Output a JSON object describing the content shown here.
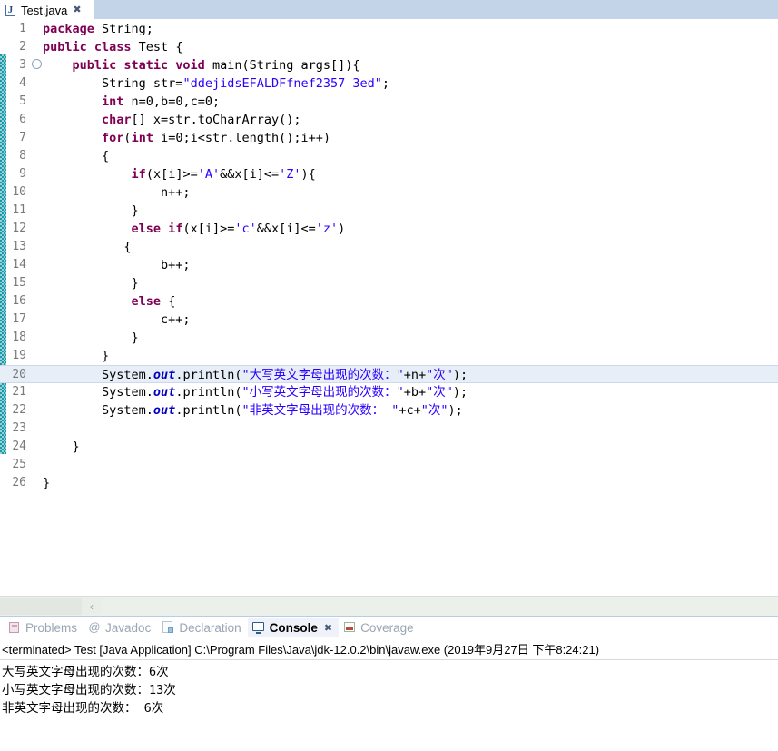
{
  "editor": {
    "tab": {
      "label": "Test.java",
      "icon": "java-file-icon",
      "close": "✖"
    },
    "lines": [
      {
        "n": "1",
        "fold": false,
        "tokens": [
          {
            "t": "kw",
            "v": "package"
          },
          {
            "t": "plain",
            "v": " String;"
          }
        ]
      },
      {
        "n": "2",
        "fold": false,
        "tokens": [
          {
            "t": "kw",
            "v": "public class"
          },
          {
            "t": "plain",
            "v": " Test {"
          }
        ]
      },
      {
        "n": "3",
        "fold": true,
        "tokens": [
          {
            "t": "plain",
            "v": "    "
          },
          {
            "t": "kw",
            "v": "public static void"
          },
          {
            "t": "plain",
            "v": " main(String args[]){"
          }
        ]
      },
      {
        "n": "4",
        "fold": false,
        "tokens": [
          {
            "t": "plain",
            "v": "        String str="
          },
          {
            "t": "str",
            "v": "\"ddejidsEFALDFfnef2357 3ed\""
          },
          {
            "t": "plain",
            "v": ";"
          }
        ]
      },
      {
        "n": "5",
        "fold": false,
        "tokens": [
          {
            "t": "plain",
            "v": "        "
          },
          {
            "t": "kw",
            "v": "int"
          },
          {
            "t": "plain",
            "v": " n=0,b=0,c=0;"
          }
        ]
      },
      {
        "n": "6",
        "fold": false,
        "tokens": [
          {
            "t": "plain",
            "v": "        "
          },
          {
            "t": "kw",
            "v": "char"
          },
          {
            "t": "plain",
            "v": "[] x=str.toCharArray();"
          }
        ]
      },
      {
        "n": "7",
        "fold": false,
        "tokens": [
          {
            "t": "plain",
            "v": "        "
          },
          {
            "t": "kw",
            "v": "for"
          },
          {
            "t": "plain",
            "v": "("
          },
          {
            "t": "kw",
            "v": "int"
          },
          {
            "t": "plain",
            "v": " i=0;i<str.length();i++)"
          }
        ]
      },
      {
        "n": "8",
        "fold": false,
        "tokens": [
          {
            "t": "plain",
            "v": "        {"
          }
        ]
      },
      {
        "n": "9",
        "fold": false,
        "tokens": [
          {
            "t": "plain",
            "v": "            "
          },
          {
            "t": "kw",
            "v": "if"
          },
          {
            "t": "plain",
            "v": "(x[i]>="
          },
          {
            "t": "str",
            "v": "'A'"
          },
          {
            "t": "plain",
            "v": "&&x[i]<="
          },
          {
            "t": "str",
            "v": "'Z'"
          },
          {
            "t": "plain",
            "v": "){"
          }
        ]
      },
      {
        "n": "10",
        "fold": false,
        "tokens": [
          {
            "t": "plain",
            "v": "                n++;"
          }
        ]
      },
      {
        "n": "11",
        "fold": false,
        "tokens": [
          {
            "t": "plain",
            "v": "            }"
          }
        ]
      },
      {
        "n": "12",
        "fold": false,
        "tokens": [
          {
            "t": "plain",
            "v": "            "
          },
          {
            "t": "kw",
            "v": "else if"
          },
          {
            "t": "plain",
            "v": "(x[i]>="
          },
          {
            "t": "str",
            "v": "'c'"
          },
          {
            "t": "plain",
            "v": "&&x[i]<="
          },
          {
            "t": "str",
            "v": "'z'"
          },
          {
            "t": "plain",
            "v": ")"
          }
        ]
      },
      {
        "n": "13",
        "fold": false,
        "tokens": [
          {
            "t": "plain",
            "v": "           {"
          }
        ]
      },
      {
        "n": "14",
        "fold": false,
        "tokens": [
          {
            "t": "plain",
            "v": "                b++;"
          }
        ]
      },
      {
        "n": "15",
        "fold": false,
        "tokens": [
          {
            "t": "plain",
            "v": "            }"
          }
        ]
      },
      {
        "n": "16",
        "fold": false,
        "tokens": [
          {
            "t": "plain",
            "v": "            "
          },
          {
            "t": "kw",
            "v": "else"
          },
          {
            "t": "plain",
            "v": " {"
          }
        ]
      },
      {
        "n": "17",
        "fold": false,
        "tokens": [
          {
            "t": "plain",
            "v": "                c++;"
          }
        ]
      },
      {
        "n": "18",
        "fold": false,
        "tokens": [
          {
            "t": "plain",
            "v": "            }"
          }
        ]
      },
      {
        "n": "19",
        "fold": false,
        "tokens": [
          {
            "t": "plain",
            "v": "        }"
          }
        ]
      },
      {
        "n": "20",
        "fold": false,
        "hl": true,
        "caret_after": 1,
        "tokens": [
          {
            "t": "plain",
            "v": "        System."
          },
          {
            "t": "fld",
            "v": "out"
          },
          {
            "t": "plain",
            "v": ".println("
          },
          {
            "t": "str",
            "v": "\"大写英文字母出现的次数：\""
          },
          {
            "t": "plain",
            "v": "+n"
          },
          {
            "t": "caret",
            "v": ""
          },
          {
            "t": "plain",
            "v": "+"
          },
          {
            "t": "str",
            "v": "\"次\""
          },
          {
            "t": "plain",
            "v": ");"
          }
        ]
      },
      {
        "n": "21",
        "fold": false,
        "tokens": [
          {
            "t": "plain",
            "v": "        System."
          },
          {
            "t": "fld",
            "v": "out"
          },
          {
            "t": "plain",
            "v": ".println("
          },
          {
            "t": "str",
            "v": "\"小写英文字母出现的次数：\""
          },
          {
            "t": "plain",
            "v": "+b+"
          },
          {
            "t": "str",
            "v": "\"次\""
          },
          {
            "t": "plain",
            "v": ");"
          }
        ]
      },
      {
        "n": "22",
        "fold": false,
        "tokens": [
          {
            "t": "plain",
            "v": "        System."
          },
          {
            "t": "fld",
            "v": "out"
          },
          {
            "t": "plain",
            "v": ".println("
          },
          {
            "t": "str",
            "v": "\"非英文字母出现的次数： \""
          },
          {
            "t": "plain",
            "v": "+c+"
          },
          {
            "t": "str",
            "v": "\"次\""
          },
          {
            "t": "plain",
            "v": ");"
          }
        ]
      },
      {
        "n": "23",
        "fold": false,
        "tokens": [
          {
            "t": "plain",
            "v": ""
          }
        ]
      },
      {
        "n": "24",
        "fold": false,
        "tokens": [
          {
            "t": "plain",
            "v": "    }"
          }
        ]
      },
      {
        "n": "25",
        "fold": false,
        "tokens": [
          {
            "t": "plain",
            "v": ""
          }
        ]
      },
      {
        "n": "26",
        "fold": false,
        "tokens": [
          {
            "t": "plain",
            "v": "}"
          }
        ]
      }
    ],
    "hscroll": {
      "left_arrow": "‹"
    }
  },
  "bottom_panel": {
    "tabs": [
      {
        "label": "Problems",
        "icon": "problems-icon",
        "active": false,
        "closable": false
      },
      {
        "label": "Javadoc",
        "icon": "javadoc-icon",
        "active": false,
        "closable": false
      },
      {
        "label": "Declaration",
        "icon": "declaration-icon",
        "active": false,
        "closable": false
      },
      {
        "label": "Console",
        "icon": "console-icon",
        "active": true,
        "closable": true
      },
      {
        "label": "Coverage",
        "icon": "coverage-icon",
        "active": false,
        "closable": false
      }
    ],
    "close_glyph": "✖",
    "launch_line": "<terminated> Test [Java Application] C:\\Program Files\\Java\\jdk-12.0.2\\bin\\javaw.exe (2019年9月27日 下午8:24:21)",
    "output": [
      "大写英文字母出现的次数：6次",
      "小写英文字母出现的次数：13次",
      "非英文字母出现的次数： 6次"
    ]
  },
  "colors": {
    "keyword": "#7f0055",
    "string": "#2a00ff",
    "field": "#0000c0",
    "tab_strip": "#c3d4e8",
    "change_bar": "#1a9aa8",
    "line_highlight": "#e8eef7"
  }
}
